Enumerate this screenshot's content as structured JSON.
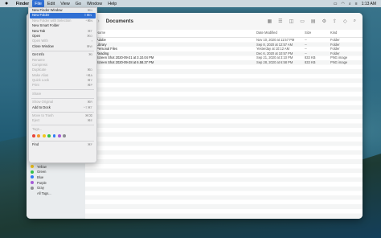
{
  "menubar": {
    "apple": "",
    "items": [
      "Finder",
      "File",
      "Edit",
      "View",
      "Go",
      "Window",
      "Help"
    ],
    "clock": "1:13 AM"
  },
  "window": {
    "title": "Documents",
    "nav_back": "‹",
    "nav_forward": "›",
    "search_icon": "search-icon",
    "columns": {
      "name": "Name",
      "date": "Date Modified",
      "size": "Size",
      "kind": "Kind"
    },
    "rows": [
      {
        "name": "Adobe",
        "date": "Nov 10, 2020 at 11:57 PM",
        "size": "--",
        "kind": "Folder"
      },
      {
        "name": "Library",
        "date": "Sep 8, 2020 at 12:57 AM",
        "size": "--",
        "kind": "Folder"
      },
      {
        "name": "Personal Files",
        "date": "Yesterday at 10:12 AM",
        "size": "--",
        "kind": "Folder"
      },
      {
        "name": "Reading",
        "date": "Dec 6, 2020 at 10:57 PM",
        "size": "--",
        "kind": "Folder"
      },
      {
        "name": "Screen Shot 2020-09-21 at 3.10.04 PM",
        "date": "Sep 21, 2020 at 3:10 PM",
        "size": "833 KB",
        "kind": "PNG image"
      },
      {
        "name": "Screen Shot 2020-09-28 at 6.58.37 PM",
        "date": "Sep 28, 2020 at 6:58 PM",
        "size": "833 KB",
        "kind": "PNG image"
      }
    ]
  },
  "sidebar": {
    "tags": [
      {
        "label": "Yellow",
        "color": "#f2c51c"
      },
      {
        "label": "Green",
        "color": "#34c24a"
      },
      {
        "label": "Blue",
        "color": "#2f7bf5"
      },
      {
        "label": "Purple",
        "color": "#a55bd8"
      },
      {
        "label": "Gray",
        "color": "#8e8e93"
      },
      {
        "label": "All Tags...",
        "color": ""
      }
    ]
  },
  "file_menu": {
    "items": [
      {
        "label": "New Finder Window",
        "shortcut": "⌘N",
        "state": "normal"
      },
      {
        "label": "New Folder",
        "shortcut": "⇧⌘N",
        "state": "highlighted"
      },
      {
        "label": "New Folder with Selection",
        "shortcut": "^⌘N",
        "state": "disabled"
      },
      {
        "label": "New Smart Folder",
        "shortcut": "",
        "state": "normal"
      },
      {
        "label": "New Tab",
        "shortcut": "⌘T",
        "state": "normal"
      },
      {
        "label": "Open",
        "shortcut": "⌘O",
        "state": "normal"
      },
      {
        "label": "Open With",
        "shortcut": "›",
        "state": "disabled"
      },
      {
        "label": "Close Window",
        "shortcut": "⌘W",
        "state": "normal"
      },
      {
        "sep": true
      },
      {
        "label": "Get Info",
        "shortcut": "⌘I",
        "state": "normal"
      },
      {
        "label": "Rename",
        "shortcut": "",
        "state": "disabled"
      },
      {
        "label": "Compress",
        "shortcut": "",
        "state": "disabled"
      },
      {
        "label": "Duplicate",
        "shortcut": "⌘D",
        "state": "disabled"
      },
      {
        "label": "Make Alias",
        "shortcut": "^⌘A",
        "state": "disabled"
      },
      {
        "label": "Quick Look",
        "shortcut": "⌘Y",
        "state": "disabled"
      },
      {
        "label": "Print",
        "shortcut": "⌘P",
        "state": "disabled"
      },
      {
        "sep": true
      },
      {
        "label": "Share",
        "shortcut": "",
        "state": "disabled"
      },
      {
        "sep": true
      },
      {
        "label": "Show Original",
        "shortcut": "⌘R",
        "state": "disabled"
      },
      {
        "label": "Add to Dock",
        "shortcut": "^⇧⌘T",
        "state": "normal"
      },
      {
        "sep": true
      },
      {
        "label": "Move to Trash",
        "shortcut": "⌘⌫",
        "state": "disabled"
      },
      {
        "label": "Eject",
        "shortcut": "⌘E",
        "state": "disabled"
      },
      {
        "sep": true
      },
      {
        "label": "Tags...",
        "shortcut": "",
        "state": "disabled"
      },
      {
        "colors": [
          "#e7463b",
          "#f29a2e",
          "#f2c51c",
          "#34c24a",
          "#2f7bf5",
          "#a55bd8",
          "#8e8e93"
        ]
      },
      {
        "sep": true
      },
      {
        "label": "Find",
        "shortcut": "⌘F",
        "state": "normal"
      }
    ]
  }
}
